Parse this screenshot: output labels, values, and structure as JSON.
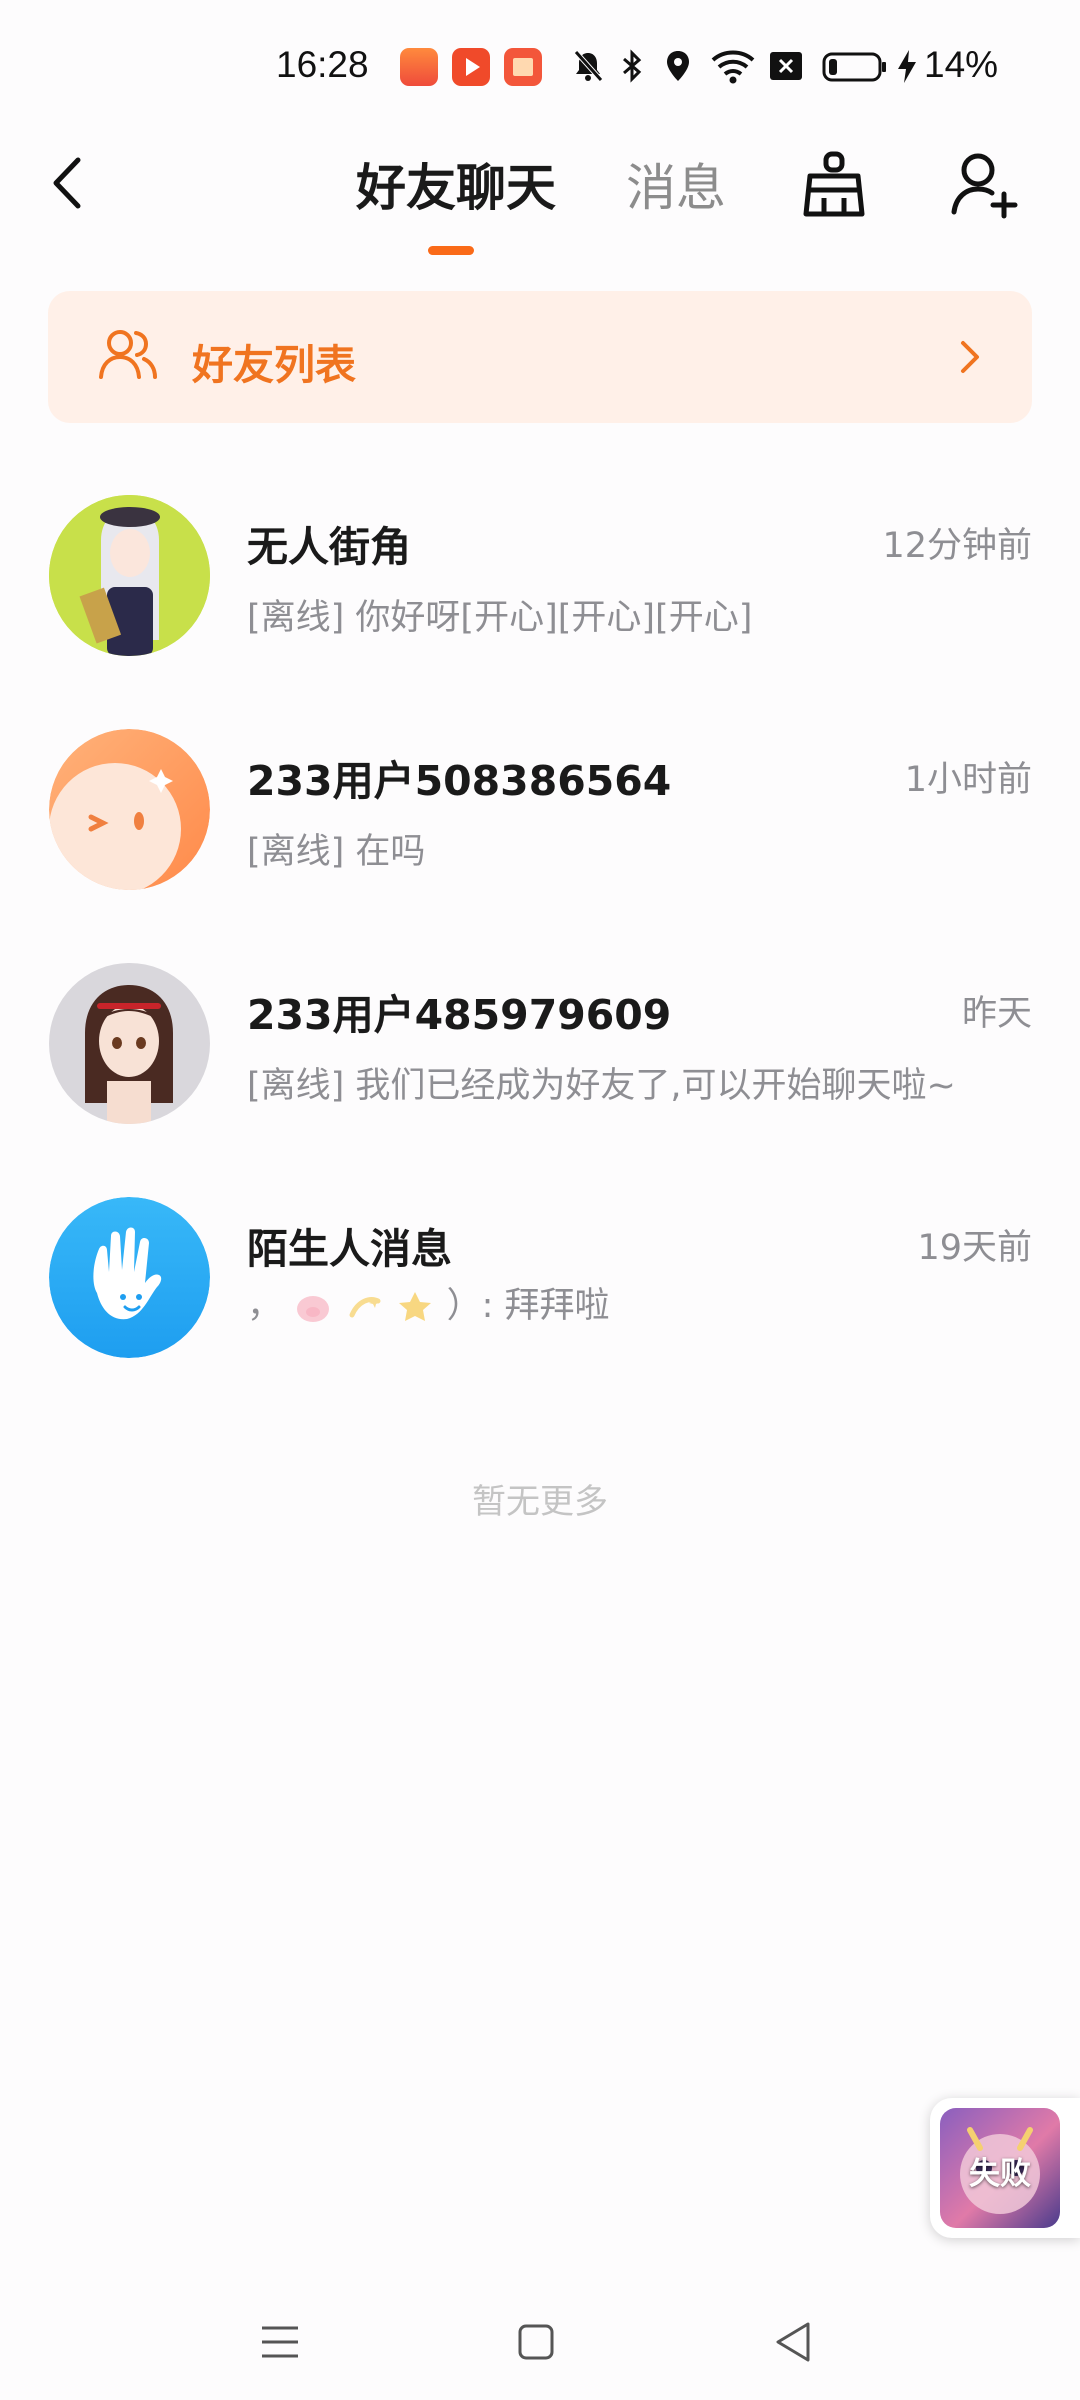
{
  "status_bar": {
    "time": "16:28",
    "battery_percent": "14%"
  },
  "header": {
    "tabs": [
      {
        "label": "好友聊天",
        "active": true
      },
      {
        "label": "消息",
        "active": false
      }
    ],
    "accent_color": "#fa6a18",
    "clean_icon": "broom-icon",
    "add_friend_icon": "add-user-icon"
  },
  "friend_list_banner": {
    "label": "好友列表",
    "icon": "friends-icon",
    "color": "#f07420"
  },
  "conversations": [
    {
      "name": "无人街角",
      "time": "12分钟前",
      "preview": "[离线] 你好呀[开心][开心][开心]"
    },
    {
      "name": "233用户508386564",
      "time": "1小时前",
      "preview": "[离线] 在吗"
    },
    {
      "name": "233用户485979609",
      "time": "昨天",
      "preview": "[离线] 我们已经成为好友了,可以开始聊天啦~"
    },
    {
      "name": "陌生人消息",
      "time": "19天前",
      "preview": "）: 拜拜啦"
    }
  ],
  "no_more_text": "暂无更多",
  "floating_game": {
    "label": "失败"
  }
}
